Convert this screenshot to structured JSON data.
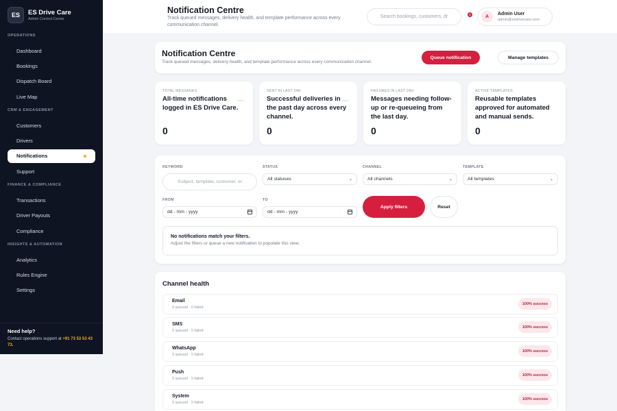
{
  "brand": {
    "logo": "ES",
    "name": "ES Drive Care",
    "subtitle": "Admin Control Center"
  },
  "sidebar": {
    "sections": [
      {
        "title": "OPERATIONS",
        "items": [
          "Dashboard",
          "Bookings",
          "Dispatch Board",
          "Live Map"
        ]
      },
      {
        "title": "CRM & ENGAGEMENT",
        "items": [
          "Customers",
          "Drivers",
          "Notifications",
          "Support"
        ]
      },
      {
        "title": "FINANCE & COMPLIANCE",
        "items": [
          "Transactions",
          "Driver Payouts",
          "Compliance"
        ]
      },
      {
        "title": "INSIGHTS & AUTOMATION",
        "items": [
          "Analytics",
          "Rules Engine",
          "Settings"
        ]
      }
    ],
    "active": "Notifications",
    "help": {
      "title": "Need help?",
      "text": "Contact operations support at",
      "phone": "+91 73 53 53 43 73."
    }
  },
  "header": {
    "title": "Notification Centre",
    "subtitle": "Track queued messages, delivery health, and template performance across every communication channel.",
    "search_placeholder": "Search bookings, customers, dr",
    "notif_count": "0",
    "user": {
      "initial": "A",
      "name": "Admin User",
      "email": "admin@esdrivecare.com"
    }
  },
  "hero": {
    "title": "Notification Centre",
    "subtitle": "Track queued messages, delivery health, and template performance across every communication channel.",
    "queue_button": "Queue notification",
    "manage_button": "Manage templates"
  },
  "stats": [
    {
      "label": "TOTAL MESSAGES",
      "desc": "All-time notifications logged in ES Drive Care.",
      "value": "0"
    },
    {
      "label": "SENT IN LAST 24H",
      "desc": "Successful deliveries in the past day across every channel.",
      "value": "0"
    },
    {
      "label": "FAILURES IN LAST 24H",
      "desc": "Messages needing follow-up or re-queueing from the last day.",
      "value": "0"
    },
    {
      "label": "ACTIVE TEMPLATES",
      "desc": "Reusable templates approved for automated and manual sends.",
      "value": "0"
    }
  ],
  "filters": {
    "keyword_label": "KEYWORD",
    "keyword_placeholder": "Subject, template, customer, or",
    "status_label": "STATUS",
    "status_value": "All statuses",
    "channel_label": "CHANNEL",
    "channel_value": "All channels",
    "template_label": "TEMPLATE",
    "template_value": "All templates",
    "from_label": "FROM",
    "from_value": "dd - mm - yyyy",
    "to_label": "TO",
    "to_value": "dd - mm - yyyy",
    "apply_button": "Apply filters",
    "reset_button": "Reset",
    "empty_title": "No notifications match your filters.",
    "empty_sub": "Adjust the filters or queue a new notification to populate this view."
  },
  "channel_health": {
    "title": "Channel health",
    "rows": [
      {
        "name": "Email",
        "meta": "0 queued · 0 failed",
        "badge": "100% success"
      },
      {
        "name": "SMS",
        "meta": "0 queued · 0 failed",
        "badge": "100% success"
      },
      {
        "name": "WhatsApp",
        "meta": "0 queued · 0 failed",
        "badge": "100% success"
      },
      {
        "name": "Push",
        "meta": "0 queued · 0 failed",
        "badge": "100% success"
      },
      {
        "name": "System",
        "meta": "0 queued · 0 failed",
        "badge": "100% success"
      }
    ]
  },
  "colors": {
    "accent": "#d61f3f",
    "sidebar": "#0e1422",
    "highlight": "#f5b400"
  }
}
